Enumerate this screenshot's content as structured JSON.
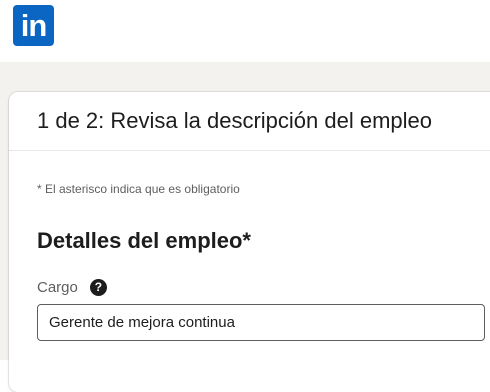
{
  "header": {
    "logo_text": "in"
  },
  "modal": {
    "title": "1 de 2: Revisa la descripción del empleo",
    "required_note": "* El asterisco indica que es obligatorio",
    "section_title": "Detalles del empleo*",
    "fields": [
      {
        "label": "Cargo",
        "help_icon": "question-circle-icon",
        "value": "Gerente de mejora continua"
      }
    ]
  },
  "colors": {
    "brand": "#0a66c2",
    "page_background": "#f4f2ee",
    "text_primary": "#1d1d1d",
    "text_secondary": "#5e5e5e"
  }
}
